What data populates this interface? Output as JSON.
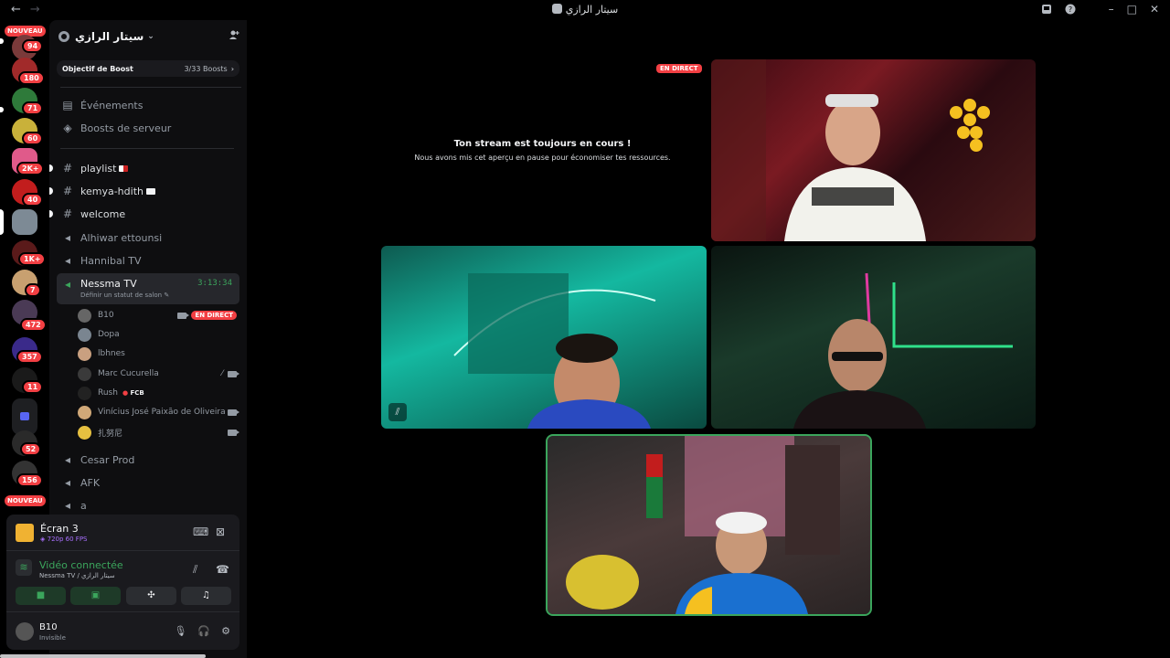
{
  "titlebar": {
    "back": "←",
    "forward": "→",
    "title": "سيتار الرازي",
    "inbox_icon": "inbox-icon",
    "help_icon": "help-icon",
    "minimize": "–",
    "maximize": "□",
    "close": "✕"
  },
  "guilds": {
    "nouveau_top": "NOUVEAU",
    "nouveau_bottom": "NOUVEAU",
    "badges": [
      "94",
      "180",
      "71",
      "60",
      "2K+",
      "40",
      "1K+",
      "7",
      "472",
      "357",
      "11",
      "52",
      "156"
    ]
  },
  "server": {
    "name": "سيتار الرازي",
    "boost_label": "Objectif de Boost",
    "boost_progress": "3/33 Boosts"
  },
  "channels": {
    "events": "Événements",
    "server_boosts": "Boosts de serveur",
    "playlist": "playlist",
    "kemya": "kemya-hdith",
    "welcome": "welcome",
    "alhiwar": "Alhiwar ettounsi",
    "hannibal": "Hannibal TV",
    "nessma": "Nessma TV",
    "nessma_timer": "3:13:34",
    "nessma_status": "Définir un statut de salon",
    "cesar": "Cesar Prod",
    "afk": "AFK",
    "a": "a"
  },
  "voice_users": [
    {
      "name": "B10",
      "live": "EN DIRECT"
    },
    {
      "name": "Dopa"
    },
    {
      "name": "lbhnes"
    },
    {
      "name": "Marc Cucurella"
    },
    {
      "name": "Rush",
      "tag": "FCB"
    },
    {
      "name": "Vinícius José Paixão de Oliveira"
    },
    {
      "name": "扎努尼"
    }
  ],
  "panel": {
    "screen_title": "Écran 3",
    "screen_sub": "720p 60 FPS",
    "video_connected": "Vidéo connectée",
    "video_location": "Nessma TV / سيتار الرازي",
    "user_name": "B10",
    "user_status": "Invisible"
  },
  "stage": {
    "live_badge": "EN DIRECT",
    "paused_title": "Ton stream est toujours en cours !",
    "paused_sub": "Nous avons mis cet aperçu en pause pour économiser tes ressources."
  }
}
